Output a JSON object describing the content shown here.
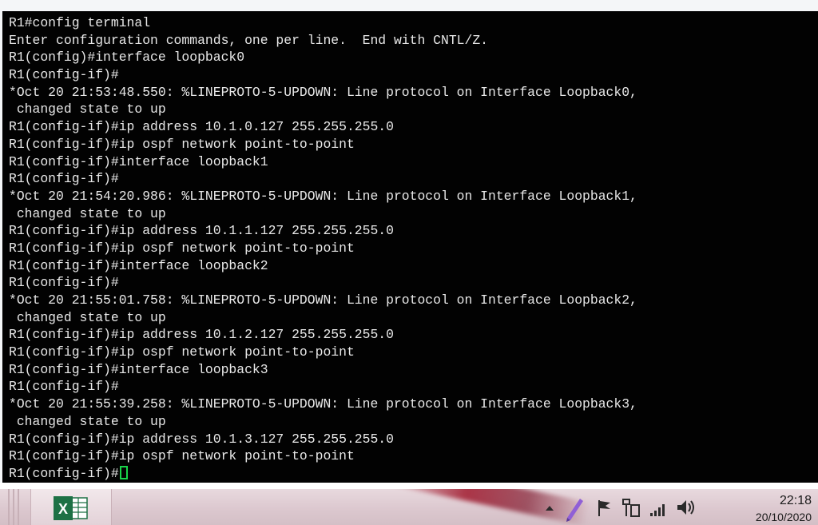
{
  "terminal": {
    "lines": [
      "R1#config terminal",
      "Enter configuration commands, one per line.  End with CNTL/Z.",
      "R1(config)#interface loopback0",
      "R1(config-if)#",
      "*Oct 20 21:53:48.550: %LINEPROTO-5-UPDOWN: Line protocol on Interface Loopback0,",
      " changed state to up",
      "R1(config-if)#ip address 10.1.0.127 255.255.255.0",
      "R1(config-if)#ip ospf network point-to-point",
      "R1(config-if)#interface loopback1",
      "R1(config-if)#",
      "*Oct 20 21:54:20.986: %LINEPROTO-5-UPDOWN: Line protocol on Interface Loopback1,",
      " changed state to up",
      "R1(config-if)#ip address 10.1.1.127 255.255.255.0",
      "R1(config-if)#ip ospf network point-to-point",
      "R1(config-if)#interface loopback2",
      "R1(config-if)#",
      "*Oct 20 21:55:01.758: %LINEPROTO-5-UPDOWN: Line protocol on Interface Loopback2,",
      " changed state to up",
      "R1(config-if)#ip address 10.1.2.127 255.255.255.0",
      "R1(config-if)#ip ospf network point-to-point",
      "R1(config-if)#interface loopback3",
      "R1(config-if)#",
      "*Oct 20 21:55:39.258: %LINEPROTO-5-UPDOWN: Line protocol on Interface Loopback3,",
      " changed state to up",
      "R1(config-if)#ip address 10.1.3.127 255.255.255.0",
      "R1(config-if)#ip ospf network point-to-point"
    ],
    "prompt": "R1(config-if)#",
    "colors": {
      "background": "#020202",
      "text": "#e8e8e8",
      "cursor": "#19d34a"
    }
  },
  "taskbar": {
    "apps": [
      {
        "name": "excel",
        "icon": "excel-icon",
        "glyph": "X"
      }
    ],
    "tray_icons": [
      "chevron-up-icon",
      "pen-icon",
      "flag-icon",
      "network-icon",
      "signal-icon",
      "volume-icon"
    ],
    "clock": {
      "time": "22:18",
      "date": "20/10/2020"
    }
  }
}
